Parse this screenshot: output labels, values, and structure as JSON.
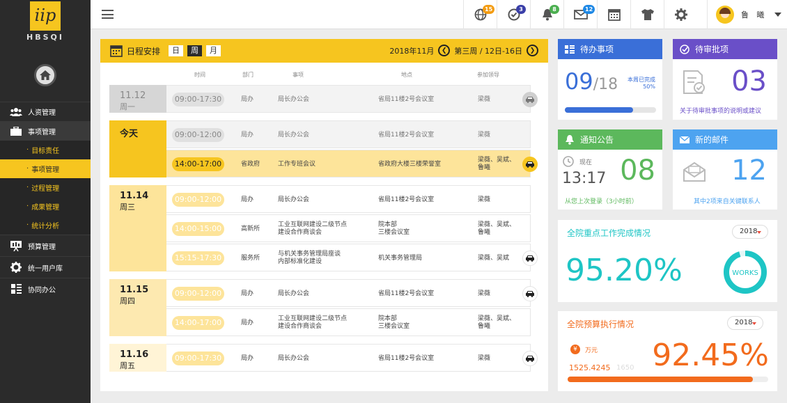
{
  "brand": {
    "logo_text": "iip",
    "logo_sub": "HBSQI"
  },
  "sidebar": {
    "items": [
      {
        "label": "人资管理"
      },
      {
        "label": "事项管理",
        "children": [
          {
            "label": "目标责任"
          },
          {
            "label": "事项管理"
          },
          {
            "label": "过程管理"
          },
          {
            "label": "成果管理"
          },
          {
            "label": "统计分析"
          }
        ]
      },
      {
        "label": "预算管理"
      },
      {
        "label": "统一用户库"
      },
      {
        "label": "协同办公"
      }
    ]
  },
  "topbar": {
    "icons": [
      {
        "name": "globe-icon",
        "badge": "15",
        "color": "#f39c12"
      },
      {
        "name": "clock-check-icon",
        "badge": "3",
        "color": "#3a3fa8"
      },
      {
        "name": "bell-icon",
        "badge": "8",
        "color": "#4caf50"
      },
      {
        "name": "mail-icon",
        "badge": "12",
        "color": "#1e88e5"
      },
      {
        "name": "calendar-icon"
      },
      {
        "name": "shirt-icon"
      },
      {
        "name": "gear-icon"
      }
    ],
    "user_name": "鲁 曦"
  },
  "schedule": {
    "title": "日程安排",
    "views": [
      "日",
      "周",
      "月"
    ],
    "selected_view": "周",
    "month": "2018年11月",
    "week": "第三周 / 12日-16日",
    "columns": [
      "时间",
      "部门",
      "事项",
      "地点",
      "参加领导"
    ],
    "days": [
      {
        "date": "11.12",
        "weekday": "周一",
        "rows": [
          {
            "time": "09:00-17:30",
            "dept": "局办",
            "item": "局长办公会",
            "place": "省局11楼2号会议室",
            "leaders": "梁薇",
            "car": true
          }
        ]
      },
      {
        "date": "今天",
        "weekday": "",
        "rows": [
          {
            "time": "09:00-12:00",
            "dept": "局办",
            "item": "局长办公会",
            "place": "省局11楼2号会议室",
            "leaders": "梁薇",
            "car": false
          },
          {
            "time": "14:00-17:00",
            "dept": "省政府",
            "item": "工作专班会议",
            "place": "省政府大楼三楼荣誉室",
            "leaders": "梁薇、吴斌、\n鲁曦",
            "car": true
          }
        ]
      },
      {
        "date": "11.14",
        "weekday": "周三",
        "rows": [
          {
            "time": "09:00-12:00",
            "dept": "局办",
            "item": "局长办公会",
            "place": "省局11楼2号会议室",
            "leaders": "梁薇",
            "car": false
          },
          {
            "time": "14:00-15:00",
            "dept": "高新所",
            "item": "工业互联网建设二级节点\n建设合作商谈会",
            "place": "院本部\n三楼会议室",
            "leaders": "梁薇、吴斌、\n鲁曦",
            "car": false
          },
          {
            "time": "15:15-17:30",
            "dept": "服务所",
            "item": "与机关事务管理局座谈\n内部标准化建设",
            "place": "机关事务管理局",
            "leaders": "梁薇、吴斌",
            "car": true
          }
        ]
      },
      {
        "date": "11.15",
        "weekday": "周四",
        "rows": [
          {
            "time": "09:00-12:00",
            "dept": "局办",
            "item": "局长办公会",
            "place": "省局11楼2号会议室",
            "leaders": "梁薇",
            "car": true
          },
          {
            "time": "14:00-17:00",
            "dept": "局办",
            "item": "工业互联网建设二级节点\n建设合作商谈会",
            "place": "院本部\n三楼会议室",
            "leaders": "梁薇、吴斌、\n鲁曦",
            "car": false
          }
        ]
      },
      {
        "date": "11.16",
        "weekday": "周五",
        "rows": [
          {
            "time": "09:00-17:30",
            "dept": "局办",
            "item": "局长办公会",
            "place": "省局11楼2号会议室",
            "leaders": "梁薇",
            "car": true
          }
        ]
      }
    ]
  },
  "todo": {
    "title": "待办事项",
    "done": "09",
    "total": "/18",
    "note1": "本周已完成",
    "note2": "50%",
    "progress": 0.75
  },
  "approval": {
    "title": "待审批项",
    "count": "03",
    "note": "关于待审批事项的说明或建议"
  },
  "notice": {
    "title": "通知公告",
    "now_label": "现在",
    "time": "13:17",
    "count": "08",
    "note": "从您上次登录（3小时前）"
  },
  "mail": {
    "title": "新的邮件",
    "count": "12",
    "note": "其中2项来自关键联系人"
  },
  "works": {
    "title": "全院重点工作完成情况",
    "year": "2018",
    "value": "95.20%",
    "ring_label": "WORKS"
  },
  "budget": {
    "title": "全院预算执行情况",
    "year": "2018",
    "unit": "万元",
    "amount": "1525.4245",
    "amount_faint": "1650",
    "value": "92.45%",
    "progress": 0.9245
  },
  "colors": {
    "yellow": "#f6c51f",
    "blue": "#3a6fd8",
    "purple": "#6a4fc8",
    "green": "#5cb85c",
    "lightblue": "#4da3f0",
    "teal": "#1ec5c5",
    "orange": "#f26b1d"
  }
}
